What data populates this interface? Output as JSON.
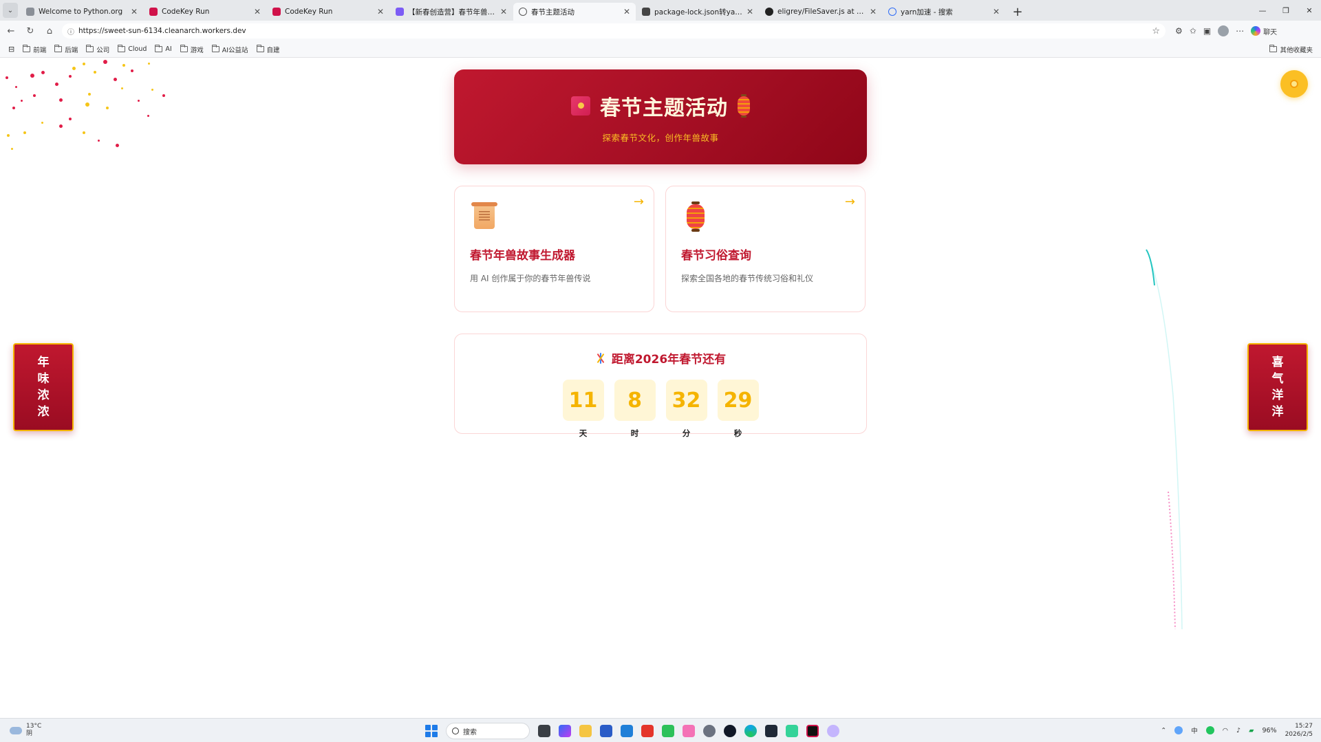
{
  "browser": {
    "tabs": [
      {
        "title": "Welcome to Python.org",
        "favicon_color": "#8a8f97",
        "active": false
      },
      {
        "title": "CodeKey Run",
        "favicon_color": "#d0124a",
        "active": false
      },
      {
        "title": "CodeKey Run",
        "favicon_color": "#d0124a",
        "active": false
      },
      {
        "title": "【新春创造营】春节年兽故事生成",
        "favicon_color": "#7c5cf5",
        "active": false
      },
      {
        "title": "春节主题活动",
        "favicon_color": "#555555",
        "active": true
      },
      {
        "title": "package-lock.json转yarn.lock方法",
        "favicon_color": "#444444",
        "active": false
      },
      {
        "title": "eligrey/FileSaver.js at 1.3.8",
        "favicon_color": "#222222",
        "active": false
      },
      {
        "title": "yarn加速 - 搜索",
        "favicon_color": "#2f6cf6",
        "active": false
      }
    ],
    "url": "https://sweet-sun-6134.cleanarch.workers.dev",
    "chat_label": "聊天",
    "bookmarks": [
      "前端",
      "后端",
      "公司",
      "Cloud",
      "AI",
      "游戏",
      "AI公益站",
      "自建"
    ],
    "other_bookmarks": "其他收藏夹"
  },
  "hero": {
    "title": "春节主题活动",
    "subtitle": "探索春节文化，创作年兽故事"
  },
  "cards": [
    {
      "icon": "scroll-icon",
      "title": "春节年兽故事生成器",
      "description": "用 AI 创作属于你的春节年兽传说",
      "arrow": "→"
    },
    {
      "icon": "lantern-icon",
      "title": "春节习俗查询",
      "description": "探索全国各地的春节传统习俗和礼仪",
      "arrow": "→"
    }
  ],
  "countdown": {
    "title": "距离2026年春节还有",
    "units": [
      {
        "value": "11",
        "label": "天"
      },
      {
        "value": "8",
        "label": "时"
      },
      {
        "value": "32",
        "label": "分"
      },
      {
        "value": "29",
        "label": "秒"
      }
    ]
  },
  "couplets": {
    "left": [
      "年",
      "味",
      "浓",
      "浓"
    ],
    "right": [
      "喜",
      "气",
      "洋",
      "洋"
    ]
  },
  "colors": {
    "primary_red": "#c0182f",
    "gold": "#f5b400",
    "countdown_bg": "#fff6d6"
  },
  "taskbar": {
    "weather_temp": "13°C",
    "weather_desc": "阴",
    "search_placeholder": "搜索",
    "ime": "中",
    "battery": "96%",
    "time": "15:27",
    "date": "2026/2/5"
  }
}
